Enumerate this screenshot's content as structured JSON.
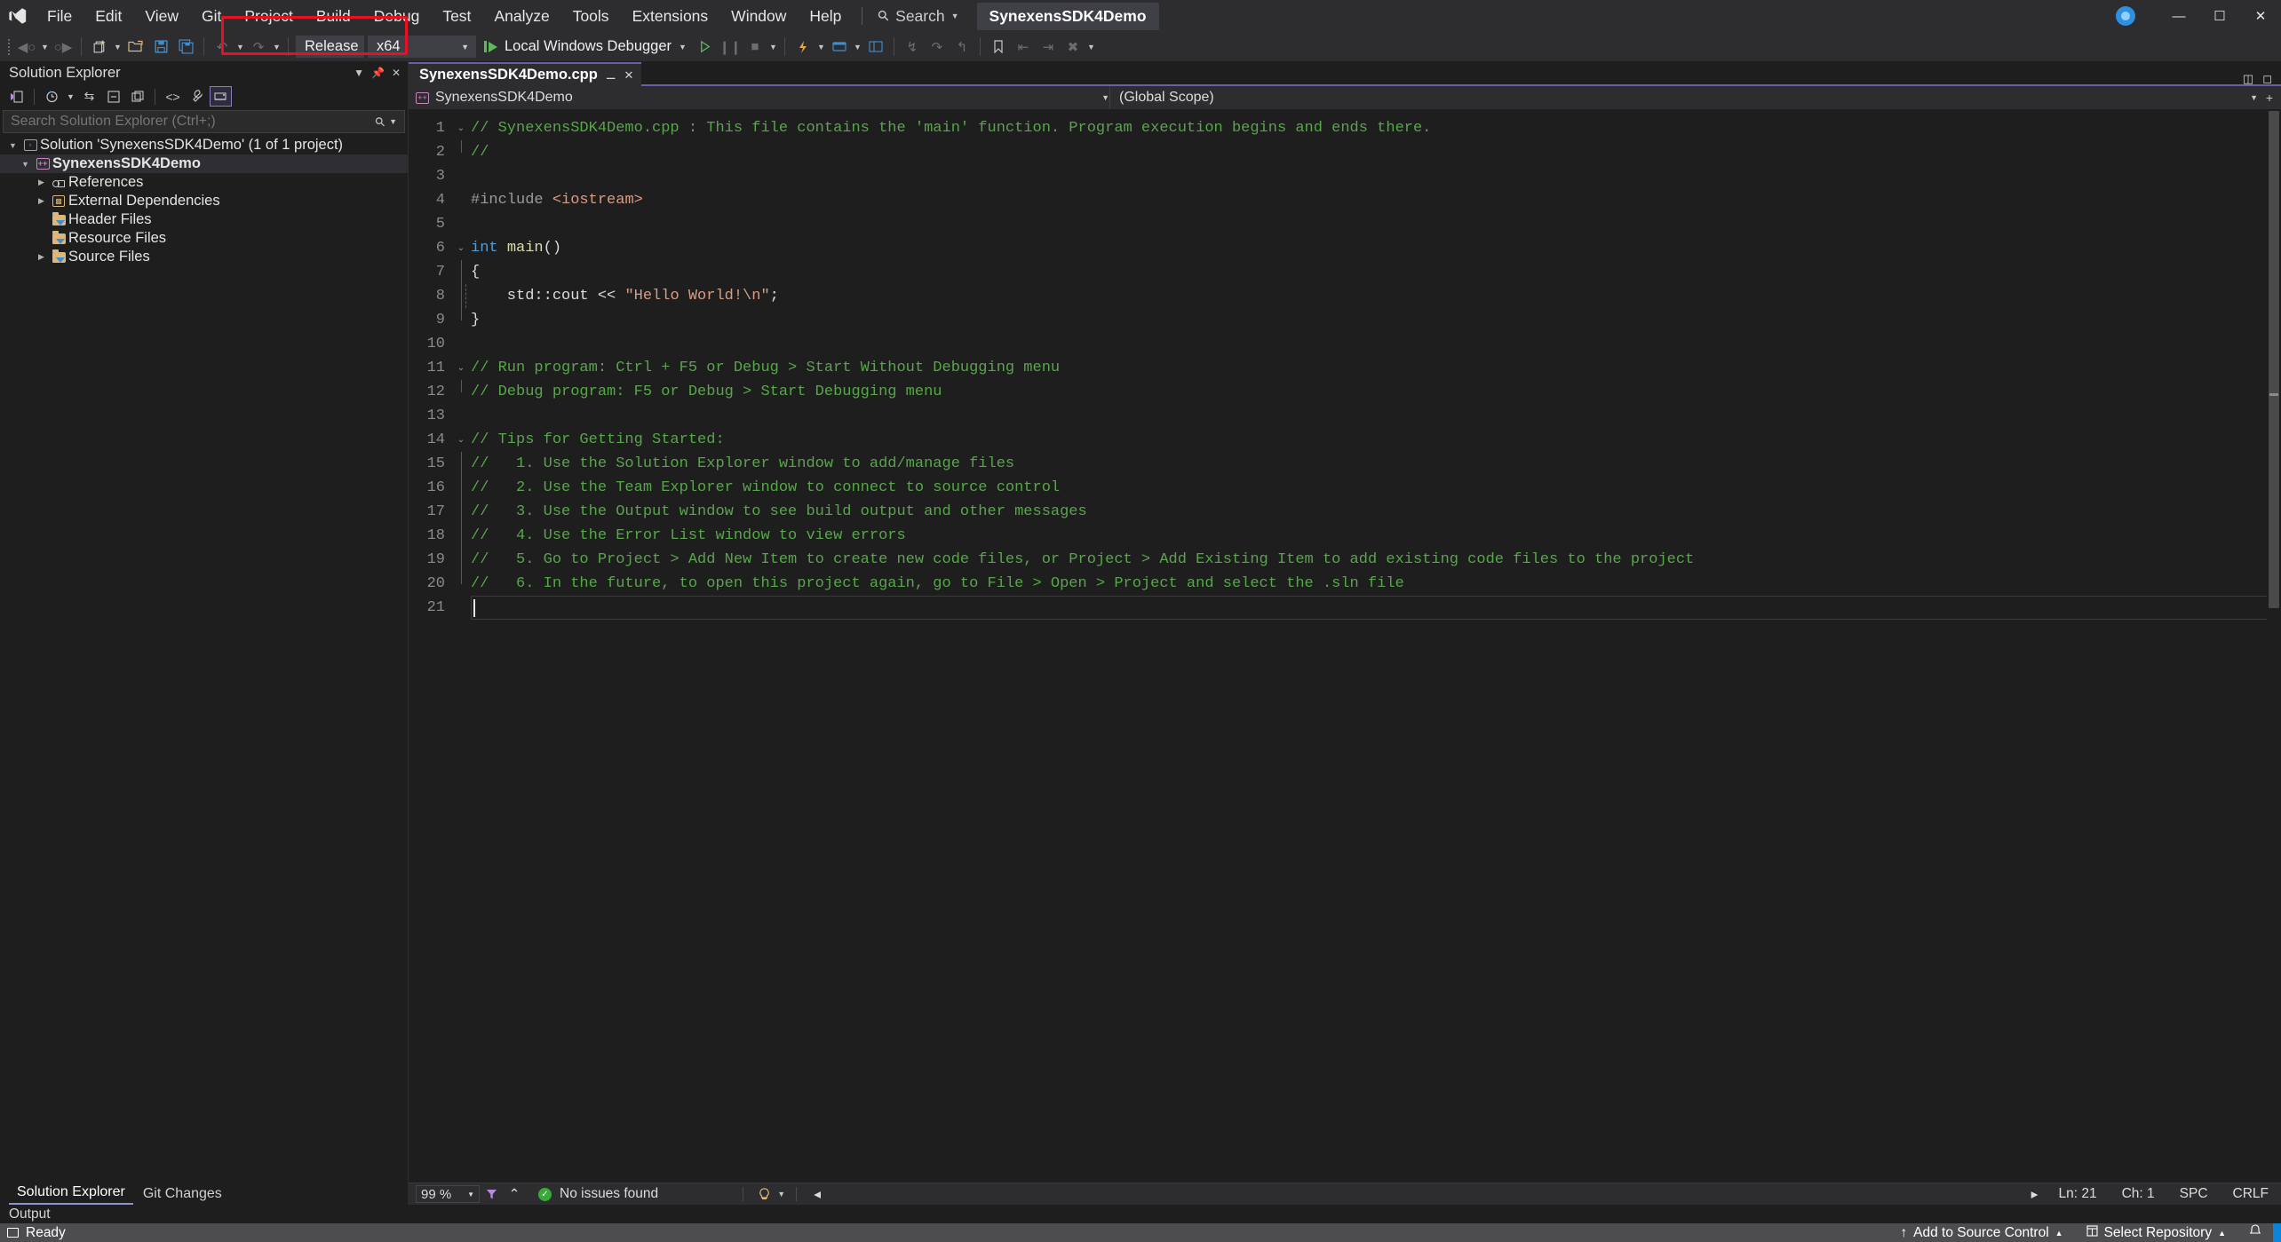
{
  "titlebar": {
    "logo_icon": "visual-studio-logo",
    "menus": [
      "File",
      "Edit",
      "View",
      "Git",
      "Project",
      "Build",
      "Debug",
      "Test",
      "Analyze",
      "Tools",
      "Extensions",
      "Window",
      "Help"
    ],
    "search_label": "Search",
    "search_icon": "search-icon",
    "project_chip": "SynexensSDK4Demo",
    "live_share_icon": "live-share-icon",
    "window_buttons": [
      "minimize",
      "maximize",
      "close"
    ],
    "window_glyphs": [
      "—",
      "☐",
      "✕"
    ]
  },
  "toolbar": {
    "nav_back_icon": "navigate-back-icon",
    "nav_forward_icon": "navigate-forward-icon",
    "new_item_icon": "new-item-icon",
    "open_file_icon": "open-file-icon",
    "save_icon": "save-icon",
    "save_all_icon": "save-all-icon",
    "undo_icon": "undo-icon",
    "redo_icon": "redo-icon",
    "configuration": "Release",
    "platform": "x64",
    "debug_target": "Local Windows Debugger",
    "run_icon": "start-debugging-icon",
    "run_no_debug_icon": "start-without-debugging-icon"
  },
  "annotation": {
    "color": "#e81123",
    "note": "red highlight rectangle around configuration and platform dropdowns"
  },
  "solution_explorer": {
    "title": "Solution Explorer",
    "toolbar_icons": [
      "pending-changes-icon",
      "view-history-icon",
      "sync-icon",
      "collapse-all-icon",
      "show-all-files-icon",
      "code-view-icon",
      "properties-wrench-icon",
      "switch-views-icon"
    ],
    "search_placeholder": "Search Solution Explorer (Ctrl+;)",
    "search_value": "",
    "tree": [
      {
        "label": "Solution 'SynexensSDK4Demo' (1 of 1 project)",
        "icon": "solution-icon",
        "indent": 0,
        "twisty": "expanded",
        "bold": false
      },
      {
        "label": "SynexensSDK4Demo",
        "icon": "cpp-project-icon",
        "indent": 1,
        "twisty": "expanded",
        "bold": true
      },
      {
        "label": "References",
        "icon": "references-icon",
        "indent": 2,
        "twisty": "collapsed",
        "bold": false
      },
      {
        "label": "External Dependencies",
        "icon": "external-dependencies-icon",
        "indent": 2,
        "twisty": "collapsed",
        "bold": false
      },
      {
        "label": "Header Files",
        "icon": "filter-folder-icon",
        "indent": 2,
        "twisty": "none",
        "bold": false
      },
      {
        "label": "Resource Files",
        "icon": "filter-folder-icon",
        "indent": 2,
        "twisty": "none",
        "bold": false
      },
      {
        "label": "Source Files",
        "icon": "filter-folder-icon",
        "indent": 2,
        "twisty": "collapsed",
        "bold": false
      }
    ],
    "bottom_tabs": [
      {
        "label": "Solution Explorer",
        "active": true
      },
      {
        "label": "Git Changes",
        "active": false
      }
    ]
  },
  "editor": {
    "tab_label": "SynexensSDK4Demo.cpp",
    "tab_modified_glyph": "●",
    "tab_close_glyph": "✕",
    "nav_project": "SynexensSDK4Demo",
    "nav_scope": "(Global Scope)",
    "lines": [
      {
        "n": "1",
        "fold": "caret",
        "tokens": [
          {
            "t": "// SynexensSDK4Demo.cpp : This file contains the 'main' function. Program execution begins and ends there.",
            "c": "cmt"
          }
        ]
      },
      {
        "n": "2",
        "fold": "end",
        "tokens": [
          {
            "t": "//",
            "c": "cmt"
          }
        ]
      },
      {
        "n": "3",
        "fold": "",
        "tokens": []
      },
      {
        "n": "4",
        "fold": "",
        "tokens": [
          {
            "t": "#include ",
            "c": "pp"
          },
          {
            "t": "<iostream>",
            "c": "hdr"
          }
        ]
      },
      {
        "n": "5",
        "fold": "",
        "tokens": []
      },
      {
        "n": "6",
        "fold": "caret",
        "tokens": [
          {
            "t": "int",
            "c": "kw"
          },
          {
            "t": " ",
            "c": "ident"
          },
          {
            "t": "main",
            "c": "fn"
          },
          {
            "t": "()",
            "c": "ident"
          }
        ]
      },
      {
        "n": "7",
        "fold": "line",
        "tokens": [
          {
            "t": "{",
            "c": "ident"
          }
        ]
      },
      {
        "n": "8",
        "fold": "dash",
        "tokens": [
          {
            "t": "    std::cout << ",
            "c": "ident"
          },
          {
            "t": "\"Hello World!\\n\"",
            "c": "str"
          },
          {
            "t": ";",
            "c": "ident"
          }
        ]
      },
      {
        "n": "9",
        "fold": "endl",
        "tokens": [
          {
            "t": "}",
            "c": "ident"
          }
        ]
      },
      {
        "n": "10",
        "fold": "",
        "tokens": []
      },
      {
        "n": "11",
        "fold": "caret",
        "tokens": [
          {
            "t": "// Run program: Ctrl + F5 or Debug > Start Without Debugging menu",
            "c": "cmt"
          }
        ]
      },
      {
        "n": "12",
        "fold": "end",
        "tokens": [
          {
            "t": "// Debug program: F5 or Debug > Start Debugging menu",
            "c": "cmt"
          }
        ]
      },
      {
        "n": "13",
        "fold": "",
        "tokens": []
      },
      {
        "n": "14",
        "fold": "caret",
        "tokens": [
          {
            "t": "// Tips for Getting Started:",
            "c": "cmt"
          }
        ]
      },
      {
        "n": "15",
        "fold": "line",
        "tokens": [
          {
            "t": "//   1. Use the Solution Explorer window to add/manage files",
            "c": "cmt"
          }
        ]
      },
      {
        "n": "16",
        "fold": "line",
        "tokens": [
          {
            "t": "//   2. Use the Team Explorer window to connect to source control",
            "c": "cmt"
          }
        ]
      },
      {
        "n": "17",
        "fold": "line",
        "tokens": [
          {
            "t": "//   3. Use the Output window to see build output and other messages",
            "c": "cmt"
          }
        ]
      },
      {
        "n": "18",
        "fold": "line",
        "tokens": [
          {
            "t": "//   4. Use the Error List window to view errors",
            "c": "cmt"
          }
        ]
      },
      {
        "n": "19",
        "fold": "line",
        "tokens": [
          {
            "t": "//   5. Go to Project > Add New Item to create new code files, or Project > Add Existing Item to add existing code files to the project",
            "c": "cmt"
          }
        ]
      },
      {
        "n": "20",
        "fold": "end",
        "tokens": [
          {
            "t": "//   6. In the future, to open this project again, go to File > Open > Project and select the .sln file",
            "c": "cmt"
          }
        ]
      },
      {
        "n": "21",
        "fold": "",
        "tokens": []
      }
    ],
    "status": {
      "zoom": "99 %",
      "issues": "No issues found",
      "issues_icon": "check-circle-icon",
      "filter_icon": "issue-filter-icon",
      "prev_icon": "previous-issue-icon",
      "line": "Ln: 21",
      "col": "Ch: 1",
      "spaces": "SPC",
      "eol": "CRLF"
    }
  },
  "output_panel": {
    "label": "Output"
  },
  "statusbar": {
    "ready": "Ready",
    "ready_icon": "ready-icon",
    "add_to_source_control": "Add to Source Control",
    "add_icon": "up-arrow-icon",
    "select_repository": "Select Repository",
    "repo_icon": "repository-icon",
    "notifications_icon": "bell-icon",
    "caret_glyph": "▲"
  }
}
